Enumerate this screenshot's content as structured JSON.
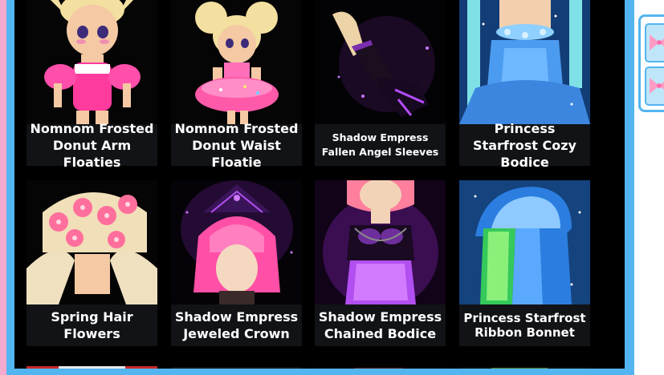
{
  "catalog": {
    "items": [
      {
        "label": "Nomnom Frosted Donut Arm Floaties"
      },
      {
        "label": "Nomnom Frosted Donut Waist Floatie"
      },
      {
        "label": "Shadow Empress Fallen Angel Sleeves"
      },
      {
        "label": "Princess Starfrost Cozy Bodice"
      },
      {
        "label": "Spring Hair Flowers"
      },
      {
        "label": "Shadow Empress Jeweled Crown"
      },
      {
        "label": "Shadow Empress Chained Bodice"
      },
      {
        "label": "Princess Starfrost Ribbon Bonnet"
      }
    ]
  },
  "colors": {
    "frame_blue": "#53b5f0",
    "frame_pink": "#f4a9cf",
    "panel_bg": "#000000",
    "label_bg": "#111316"
  },
  "side_panel": {
    "icons": [
      "pink-bow-icon",
      "pink-bow-icon"
    ]
  }
}
